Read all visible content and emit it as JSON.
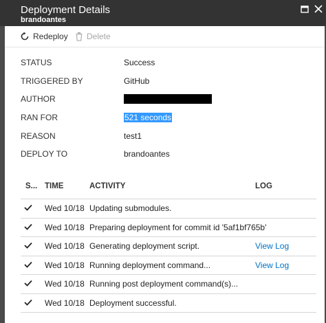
{
  "window": {
    "title": "Deployment Details",
    "subtitle": "brandoantes"
  },
  "toolbar": {
    "redeploy_label": "Redeploy",
    "delete_label": "Delete"
  },
  "properties": [
    {
      "label": "STATUS",
      "value": "Success"
    },
    {
      "label": "TRIGGERED BY",
      "value": "GitHub"
    },
    {
      "label": "AUTHOR",
      "value": ""
    },
    {
      "label": "RAN FOR",
      "value": "521 seconds"
    },
    {
      "label": "REASON",
      "value": "test1"
    },
    {
      "label": "DEPLOY TO",
      "value": "brandoantes"
    }
  ],
  "table": {
    "headers": {
      "status": "S...",
      "time": "TIME",
      "activity": "ACTIVITY",
      "log": "LOG"
    },
    "rows": [
      {
        "time": "Wed 10/18",
        "activity": "Updating submodules.",
        "log": ""
      },
      {
        "time": "Wed 10/18",
        "activity": "Preparing deployment for commit id '5af1bf765b'",
        "log": ""
      },
      {
        "time": "Wed 10/18",
        "activity": "Generating deployment script.",
        "log": "View Log"
      },
      {
        "time": "Wed 10/18",
        "activity": "Running deployment command...",
        "log": "View Log"
      },
      {
        "time": "Wed 10/18",
        "activity": "Running post deployment command(s)...",
        "log": ""
      },
      {
        "time": "Wed 10/18",
        "activity": "Deployment successful.",
        "log": ""
      }
    ]
  },
  "colors": {
    "titlebar": "#333333",
    "link": "#0072c6",
    "selection": "#3399ff",
    "disabled": "#a6a6a6"
  }
}
